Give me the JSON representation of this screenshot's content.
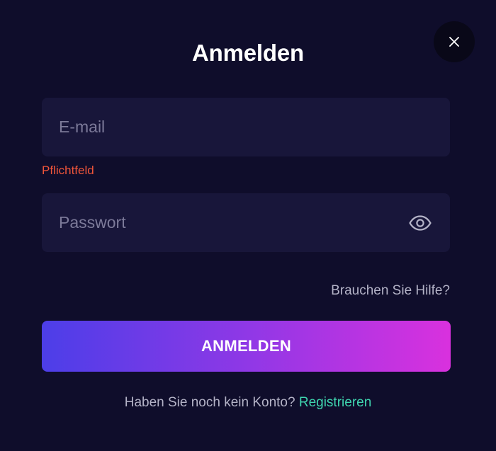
{
  "modal": {
    "title": "Anmelden",
    "close_icon": "close-icon"
  },
  "form": {
    "email": {
      "placeholder": "E-mail",
      "value": "",
      "error": "Pflichtfeld"
    },
    "password": {
      "placeholder": "Passwort",
      "value": "",
      "toggle_icon": "eye-icon"
    },
    "help_link": "Brauchen Sie Hilfe?",
    "submit_label": "ANMELDEN"
  },
  "footer": {
    "prompt": "Haben Sie noch kein Konto?",
    "register_link": "Registrieren"
  },
  "colors": {
    "background": "#0f0d2b",
    "field_background": "#18163a",
    "error": "#f0553a",
    "link_accent": "#3fd6b0",
    "button_gradient_start": "#4c3ee8",
    "button_gradient_end": "#d931de"
  }
}
